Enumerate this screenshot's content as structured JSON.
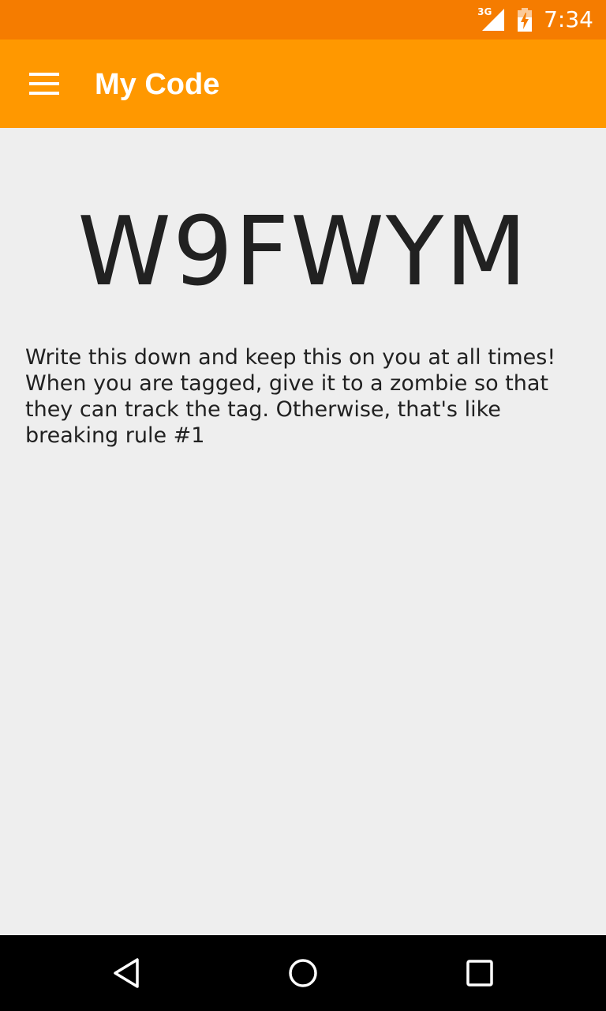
{
  "status_bar": {
    "network_type": "3G",
    "time": "7:34",
    "icons": [
      "signal-icon",
      "battery-charging-icon"
    ]
  },
  "app_bar": {
    "menu_icon": "hamburger-menu-icon",
    "title": "My Code"
  },
  "main": {
    "code": "W9FWYM",
    "instructions": "Write this down and keep this on you at all times! When you are tagged, give it to a zombie so that they can track the tag. Otherwise, that's like breaking rule #1"
  },
  "nav_bar": {
    "buttons": [
      "back-icon",
      "home-icon",
      "recents-icon"
    ]
  },
  "colors": {
    "status_bar": "#f57c00",
    "app_bar": "#ff9800",
    "background": "#eeeeee",
    "text": "#212121",
    "nav_bar": "#000000"
  }
}
